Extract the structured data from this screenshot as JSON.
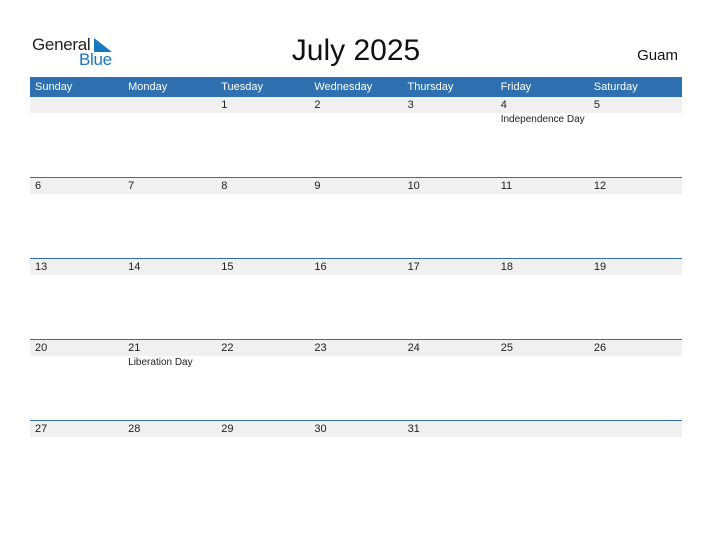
{
  "logo": {
    "word1": "General",
    "word2": "Blue"
  },
  "title": "July 2025",
  "country": "Guam",
  "colors": {
    "accent": "#2e70b0",
    "logo_blue": "#1a78c2",
    "day_bar": "#f0f0f0"
  },
  "weekdays": [
    "Sunday",
    "Monday",
    "Tuesday",
    "Wednesday",
    "Thursday",
    "Friday",
    "Saturday"
  ],
  "weeks": [
    [
      {
        "day": "",
        "event": ""
      },
      {
        "day": "",
        "event": ""
      },
      {
        "day": "1",
        "event": ""
      },
      {
        "day": "2",
        "event": ""
      },
      {
        "day": "3",
        "event": ""
      },
      {
        "day": "4",
        "event": "Independence Day"
      },
      {
        "day": "5",
        "event": ""
      }
    ],
    [
      {
        "day": "6",
        "event": ""
      },
      {
        "day": "7",
        "event": ""
      },
      {
        "day": "8",
        "event": ""
      },
      {
        "day": "9",
        "event": ""
      },
      {
        "day": "10",
        "event": ""
      },
      {
        "day": "11",
        "event": ""
      },
      {
        "day": "12",
        "event": ""
      }
    ],
    [
      {
        "day": "13",
        "event": ""
      },
      {
        "day": "14",
        "event": ""
      },
      {
        "day": "15",
        "event": ""
      },
      {
        "day": "16",
        "event": ""
      },
      {
        "day": "17",
        "event": ""
      },
      {
        "day": "18",
        "event": ""
      },
      {
        "day": "19",
        "event": ""
      }
    ],
    [
      {
        "day": "20",
        "event": ""
      },
      {
        "day": "21",
        "event": "Liberation Day"
      },
      {
        "day": "22",
        "event": ""
      },
      {
        "day": "23",
        "event": ""
      },
      {
        "day": "24",
        "event": ""
      },
      {
        "day": "25",
        "event": ""
      },
      {
        "day": "26",
        "event": ""
      }
    ],
    [
      {
        "day": "27",
        "event": ""
      },
      {
        "day": "28",
        "event": ""
      },
      {
        "day": "29",
        "event": ""
      },
      {
        "day": "30",
        "event": ""
      },
      {
        "day": "31",
        "event": ""
      },
      {
        "day": "",
        "event": ""
      },
      {
        "day": "",
        "event": ""
      }
    ]
  ]
}
